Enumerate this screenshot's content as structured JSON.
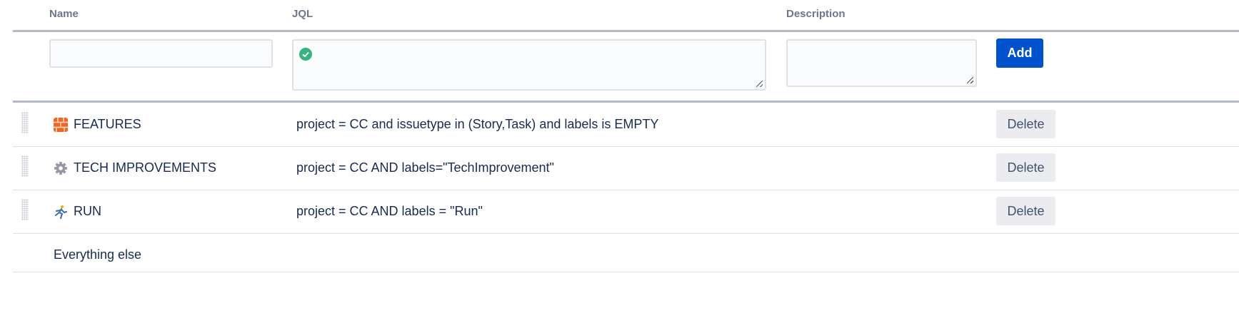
{
  "header": {
    "name": "Name",
    "jql": "JQL",
    "description": "Description"
  },
  "new_row": {
    "name_value": "",
    "jql_value": "",
    "description_value": "",
    "add_label": "Add",
    "jql_status": "valid"
  },
  "rows": [
    {
      "icon": "brick-wall-icon",
      "name": "FEATURES",
      "jql": "project = CC and issuetype in (Story,Task) and labels is EMPTY",
      "delete_label": "Delete"
    },
    {
      "icon": "gear-icon",
      "name": "TECH IMPROVEMENTS",
      "jql": "project = CC AND labels=\"TechImprovement\"",
      "delete_label": "Delete"
    },
    {
      "icon": "runner-icon",
      "name": "RUN",
      "jql": "project = CC AND labels = \"Run\"",
      "delete_label": "Delete"
    }
  ],
  "fallback_row": {
    "name": "Everything else"
  },
  "colors": {
    "accent": "#0052cc",
    "valid": "#36b37e",
    "brick": "#f26522"
  }
}
